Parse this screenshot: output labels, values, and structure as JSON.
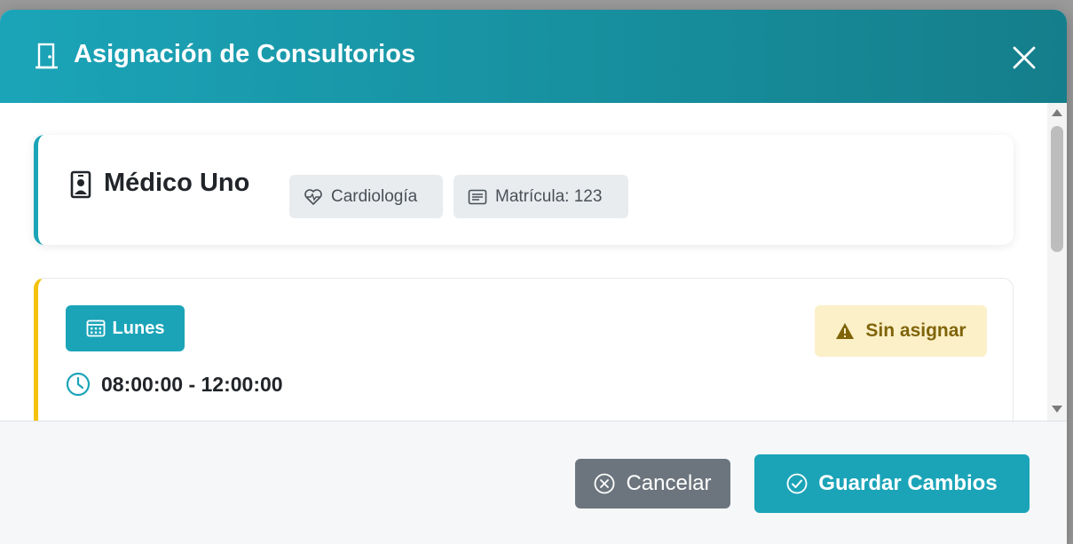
{
  "modal": {
    "title": "Asignación de Consultorios",
    "close_label": "×"
  },
  "doctor": {
    "name": "Médico Uno",
    "specialty": "Cardiología",
    "license": "Matrícula: 123"
  },
  "schedule": {
    "day": "Lunes",
    "time_range": "08:00:00 - 12:00:00",
    "status": "Sin asignar"
  },
  "footer": {
    "cancel_label": "Cancelar",
    "save_label": "Guardar Cambios"
  },
  "colors": {
    "primary": "#1ba4b8",
    "warning_border": "#f4c20d",
    "warning_bg": "#fcf0c8",
    "warning_text": "#80640a",
    "secondary": "#6c757d"
  },
  "icons": {
    "header": "door-icon",
    "close": "close-icon",
    "doctor": "badge-icon",
    "specialty": "heart-pulse-icon",
    "license": "card-text-icon",
    "day": "calendar-icon",
    "status": "warning-triangle-icon",
    "time": "clock-icon",
    "cancel": "x-circle-icon",
    "save": "check-circle-icon"
  }
}
